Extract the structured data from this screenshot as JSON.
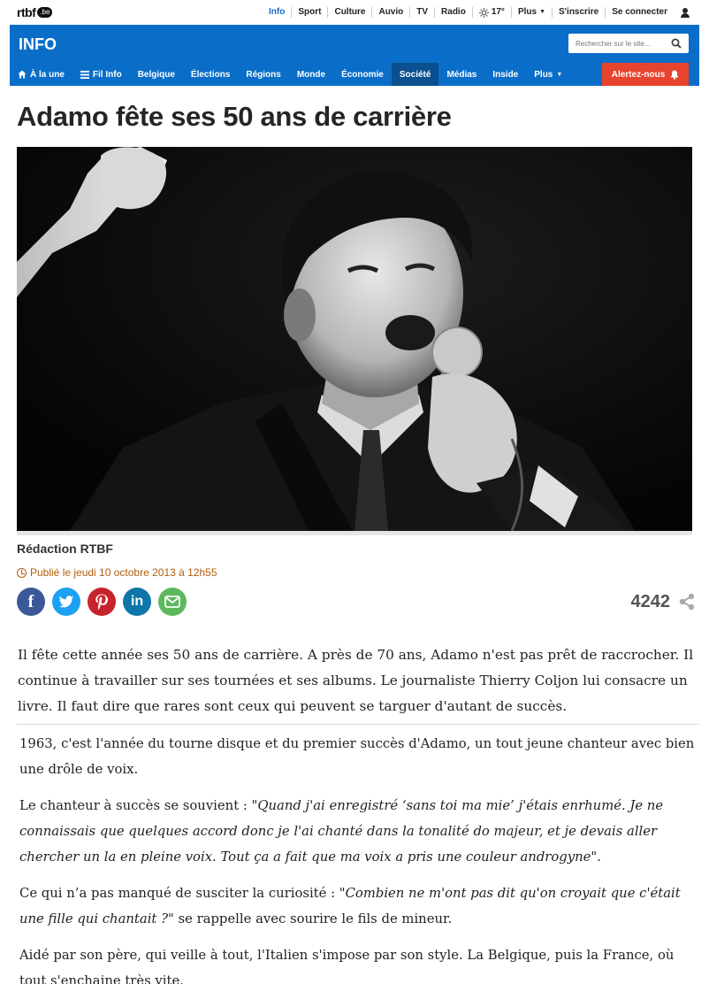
{
  "topbar": {
    "logo_text": "rtbf",
    "logo_badge": ".be",
    "nav": [
      "Info",
      "Sport",
      "Culture",
      "Auvio",
      "TV",
      "Radio"
    ],
    "weather": "17°",
    "more": "Plus",
    "signup": "S'inscrire",
    "login": "Se connecter"
  },
  "header": {
    "title": "INFO",
    "search_placeholder": "Rechercher sur le site..."
  },
  "mainnav": {
    "items": [
      "À la une",
      "Fil Info",
      "Belgique",
      "Élections",
      "Régions",
      "Monde",
      "Économie",
      "Société",
      "Médias",
      "Inside",
      "Plus"
    ],
    "active": "Société",
    "alert_label": "Alertez-nous"
  },
  "article": {
    "headline": "Adamo fête ses 50 ans de carrière",
    "author": "Rédaction RTBF",
    "published": "Publié le jeudi 10 octobre 2013 à 12h55",
    "share_count": "4242",
    "lead": "Il fête cette année ses 50 ans de carrière. A près de 70 ans, Adamo n'est pas prêt de raccrocher. Il continue à travailler sur ses tournées et ses albums. Le journaliste Thierry Coljon lui consacre un livre. Il faut dire que rares sont ceux qui peuvent se targuer d'autant de succès.",
    "p1": "1963, c'est l'année du tourne disque et du premier succès d'Adamo, un tout jeune chanteur avec bien une drôle de voix.",
    "p2_a": "Le chanteur à succès se souvient : \"",
    "p2_quote": "Quand j'ai enregistré ‘sans toi ma mie’ j'étais enrhumé. Je ne connaissais que quelques accord donc je l'ai chanté dans la tonalité do majeur, et je devais aller chercher un la en pleine voix. Tout ça a fait que ma voix a pris une couleur androgyne\".",
    "p3_a": "Ce qui n’a pas manqué de susciter la curiosité : ",
    "p3_quote": "\"Combien ne m'ont pas dit qu'on croyait que c'était une fille qui chantait ?\"",
    "p3_b": " se rappelle avec sourire le fils de mineur.",
    "p4": "Aidé par son père, qui veille à tout, l'Italien s'impose par son style. La Belgique, puis la France, où tout s'enchaine très vite."
  },
  "colors": {
    "brand_blue": "#0a6ec8",
    "active_nav": "#0b4f8e",
    "alert_red": "#e8432c",
    "date_orange": "#b15c0e"
  }
}
